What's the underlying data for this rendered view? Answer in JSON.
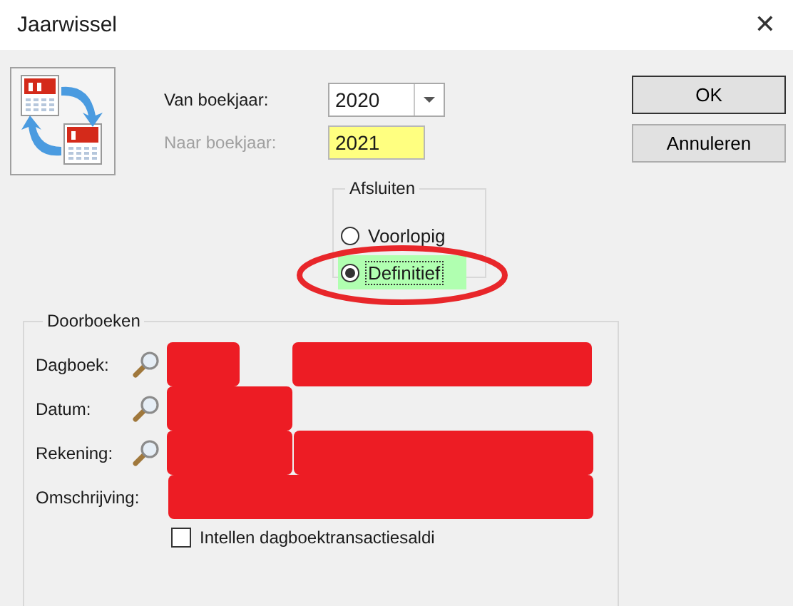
{
  "window": {
    "title": "Jaarwissel",
    "close": "✕"
  },
  "from_year": {
    "label": "Van boekjaar:",
    "value": "2020",
    "disabled": false
  },
  "to_year": {
    "label": "Naar boekjaar:",
    "value": "2021",
    "disabled": true
  },
  "close_group": {
    "title": "Afsluiten",
    "options": [
      {
        "label": "Voorlopig",
        "selected": false
      },
      {
        "label": "Definitief",
        "selected": true
      }
    ]
  },
  "buttons": [
    "OK",
    "Annuleren"
  ],
  "post_group": {
    "title": "Doorboeken",
    "rows": [
      {
        "label": "Dagboek:",
        "lookup": true
      },
      {
        "label": "Datum:",
        "lookup": true
      },
      {
        "label": "Rekening:",
        "lookup": true
      },
      {
        "label": "Omschrijving:",
        "lookup": false
      }
    ],
    "checkbox": {
      "label": "Intellen dagboektransactiesaldi",
      "checked": false
    }
  }
}
